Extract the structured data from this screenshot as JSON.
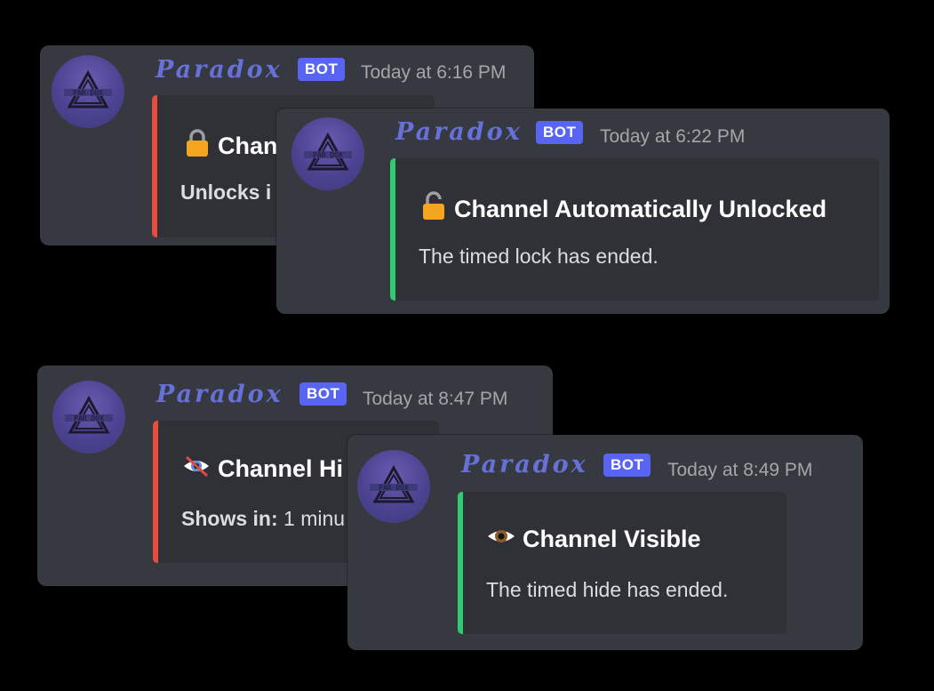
{
  "colors": {
    "card_bg": "#36393f",
    "embed_bg": "#2f3136",
    "red_bar": "#e74c3c",
    "green_bar": "#2ecc71",
    "bot_badge": "#5865f2",
    "username": "#6670d8"
  },
  "cards": [
    {
      "username": "Paradox",
      "badge": "BOT",
      "timestamp": "Today at 6:16 PM",
      "embed": {
        "icon": "lock-icon",
        "title": "Chan",
        "desc_label": "Unlocks i",
        "desc_value": ""
      }
    },
    {
      "username": "Paradox",
      "badge": "BOT",
      "timestamp": "Today at 6:22 PM",
      "embed": {
        "icon": "unlock-icon",
        "title": "Channel Automatically Unlocked",
        "desc": "The timed lock has ended."
      }
    },
    {
      "username": "Paradox",
      "badge": "BOT",
      "timestamp": "Today at 8:47 PM",
      "embed": {
        "icon": "eye-slash-icon",
        "title": "Channel Hi",
        "desc_label": "Shows in:",
        "desc_value": " 1 minu"
      }
    },
    {
      "username": "Paradox",
      "badge": "BOT",
      "timestamp": "Today at 8:49 PM",
      "embed": {
        "icon": "eye-icon",
        "title": "Channel Visible",
        "desc": "The timed hide has ended."
      }
    }
  ]
}
